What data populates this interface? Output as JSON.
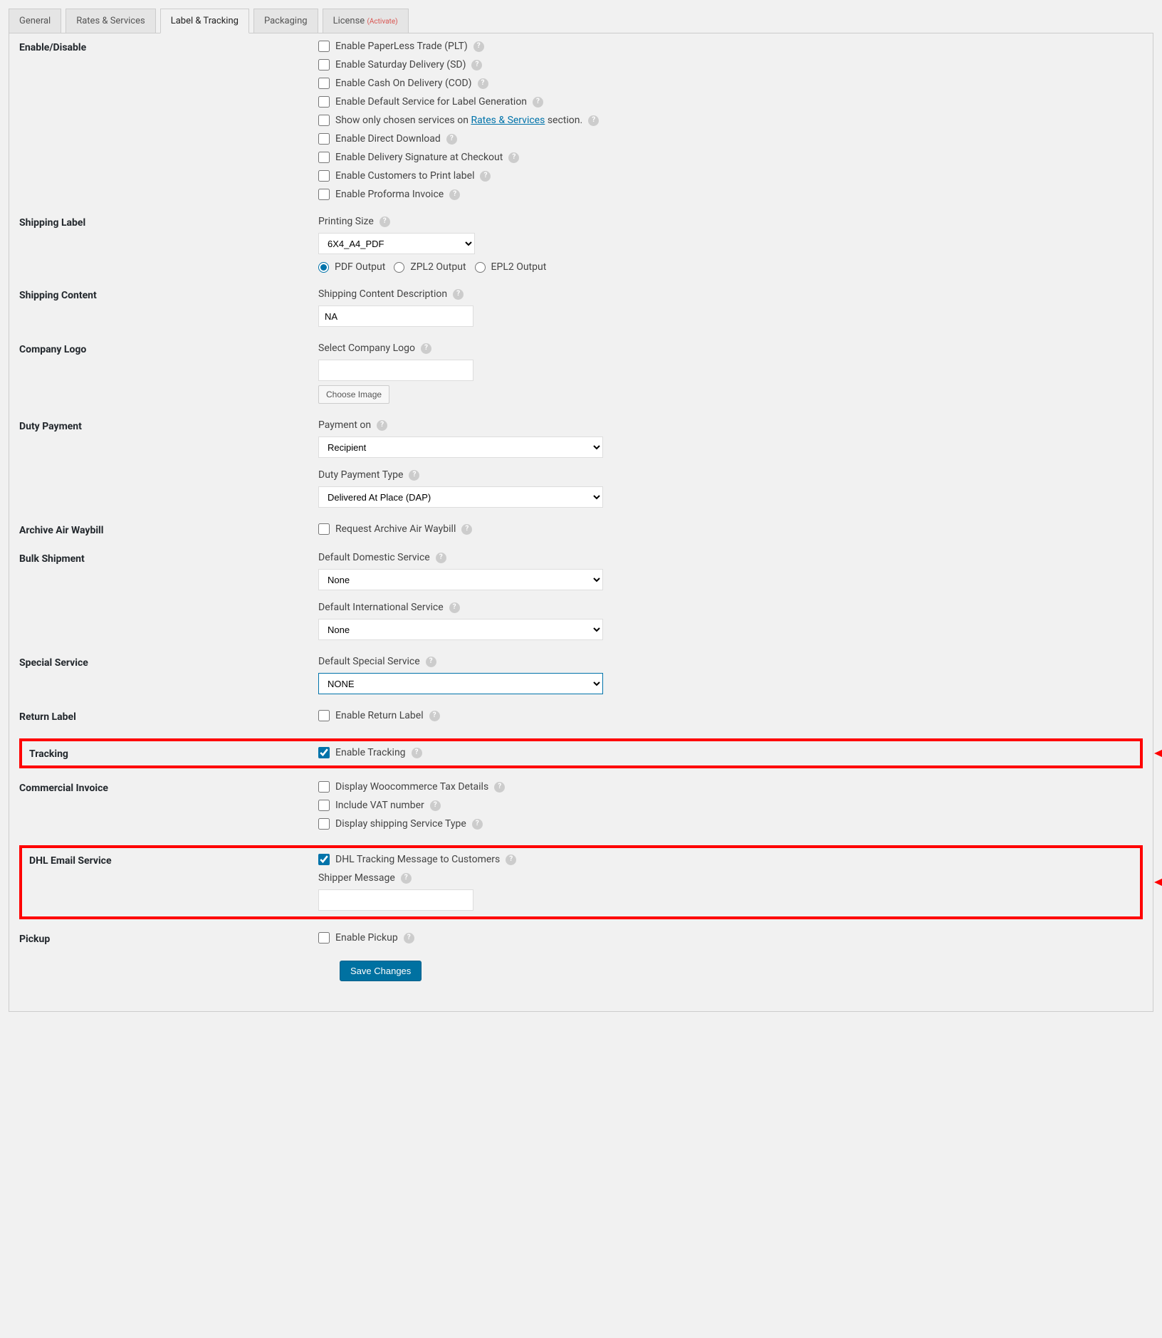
{
  "tabs": [
    {
      "label": "General"
    },
    {
      "label": "Rates & Services"
    },
    {
      "label": "Label & Tracking",
      "active": true
    },
    {
      "label": "Packaging"
    },
    {
      "label": "License",
      "activate": "(Activate)"
    }
  ],
  "sections": {
    "enable_disable": {
      "title": "Enable/Disable",
      "options": [
        {
          "label": "Enable PaperLess Trade (PLT)",
          "checked": false,
          "help": true
        },
        {
          "label": "Enable Saturday Delivery (SD)",
          "checked": false,
          "help": true
        },
        {
          "label": "Enable Cash On Delivery (COD)",
          "checked": false,
          "help": true
        },
        {
          "label": "Enable Default Service for Label Generation",
          "checked": false,
          "help": true
        },
        {
          "label_pre": "Show only chosen services on ",
          "link": "Rates & Services",
          "label_post": " section.",
          "checked": false,
          "help": true
        },
        {
          "label": "Enable Direct Download",
          "checked": false,
          "help": true
        },
        {
          "label": "Enable Delivery Signature at Checkout",
          "checked": false,
          "help": true
        },
        {
          "label": "Enable Customers to Print label",
          "checked": false,
          "help": true
        },
        {
          "label": "Enable Proforma Invoice",
          "checked": false,
          "help": true
        }
      ]
    },
    "shipping_label": {
      "title": "Shipping Label",
      "printing_size_label": "Printing Size",
      "printing_size_value": "6X4_A4_PDF",
      "output_options": [
        {
          "label": "PDF Output",
          "checked": true
        },
        {
          "label": "ZPL2 Output",
          "checked": false
        },
        {
          "label": "EPL2 Output",
          "checked": false
        }
      ]
    },
    "shipping_content": {
      "title": "Shipping Content",
      "desc_label": "Shipping Content Description",
      "desc_value": "NA"
    },
    "company_logo": {
      "title": "Company Logo",
      "select_label": "Select Company Logo",
      "input_value": "",
      "choose_btn": "Choose Image"
    },
    "duty_payment": {
      "title": "Duty Payment",
      "payment_on_label": "Payment on",
      "payment_on_value": "Recipient",
      "type_label": "Duty Payment Type",
      "type_value": "Delivered At Place (DAP)"
    },
    "archive_awb": {
      "title": "Archive Air Waybill",
      "option": {
        "label": "Request Archive Air Waybill",
        "checked": false
      }
    },
    "bulk_shipment": {
      "title": "Bulk Shipment",
      "domestic_label": "Default Domestic Service",
      "domestic_value": "None",
      "intl_label": "Default International Service",
      "intl_value": "None"
    },
    "special_service": {
      "title": "Special Service",
      "label": "Default Special Service",
      "value": "NONE"
    },
    "return_label": {
      "title": "Return Label",
      "option": {
        "label": "Enable Return Label",
        "checked": false
      }
    },
    "tracking": {
      "title": "Tracking",
      "option": {
        "label": "Enable Tracking",
        "checked": true
      }
    },
    "commercial_invoice": {
      "title": "Commercial Invoice",
      "options": [
        {
          "label": "Display Woocommerce Tax Details",
          "checked": false
        },
        {
          "label": "Include VAT number",
          "checked": false
        },
        {
          "label": "Display shipping Service Type",
          "checked": false
        }
      ]
    },
    "dhl_email": {
      "title": "DHL Email Service",
      "option": {
        "label": "DHL Tracking Message to Customers",
        "checked": true
      },
      "shipper_label": "Shipper Message",
      "shipper_value": ""
    },
    "pickup": {
      "title": "Pickup",
      "option": {
        "label": "Enable Pickup",
        "checked": false
      }
    }
  },
  "save_btn": "Save Changes"
}
